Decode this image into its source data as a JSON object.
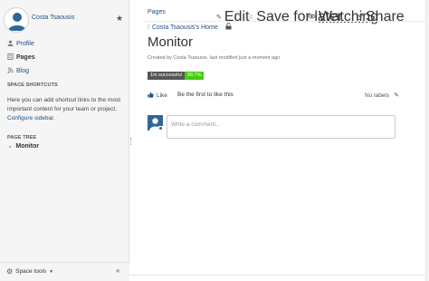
{
  "sidebar": {
    "space_name": "Costa Tsaousis",
    "nav": [
      {
        "icon": "profile-icon",
        "glyph": "👤",
        "label": "Profile"
      },
      {
        "icon": "pages-icon",
        "glyph": "☰",
        "label": "Pages"
      },
      {
        "icon": "blog-icon",
        "glyph": "❞",
        "label": "Blog"
      }
    ],
    "shortcuts_title": "SPACE SHORTCUTS",
    "shortcuts_text": "Here you can add shortcut links to the most important content for your team or project.",
    "configure_link": "Configure sidebar.",
    "page_tree_title": "PAGE TREE",
    "tree_item": "Monitor",
    "space_tools": "Space tools",
    "collapse_glyph": "«"
  },
  "toolbar": {
    "breadcrumb_top": "Pages",
    "edit": "Edit",
    "save_for_later": "Save for later",
    "watching": "Watching",
    "share": "Share"
  },
  "page": {
    "crumb": "Costa Tsaousis's Home",
    "title": "Monitor",
    "meta": "Created by Costa Tsaousis, last modified just a moment ago",
    "badge_label": "1m successful",
    "badge_value": "99.7%",
    "like": "Like",
    "like_text": "Be the first to like this",
    "labels": "No labels",
    "comment_placeholder": "Write a comment..."
  },
  "colors": {
    "link": "#205081",
    "badge_green": "#44cc11"
  }
}
